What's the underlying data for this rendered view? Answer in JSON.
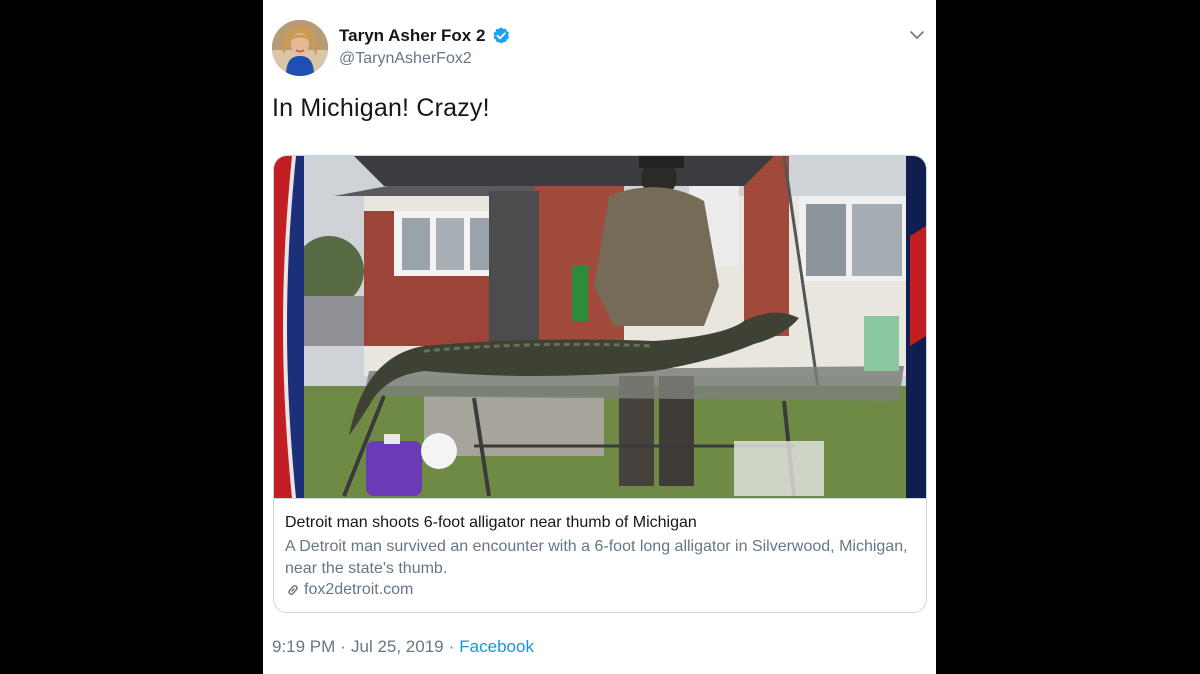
{
  "tweet": {
    "display_name": "Taryn Asher Fox 2",
    "handle": "@TarynAsherFox2",
    "text": "In Michigan! Crazy!",
    "time": "9:19 PM",
    "separator1": "·",
    "date": "Jul 25, 2019",
    "separator2": "·",
    "source": "Facebook"
  },
  "card": {
    "title": "Detroit man shoots 6-foot alligator near thumb of Michigan",
    "description": "A Detroit man survived an encounter with a 6-foot long alligator in Silverwood, Michigan, near the state's thumb.",
    "domain": "fox2detroit.com"
  },
  "icons": {
    "verified": "verified-badge-icon",
    "caret": "chevron-down-icon",
    "link": "link-icon"
  },
  "colors": {
    "verified": "#1da1f2",
    "link": "#1b95e0",
    "secondary_text": "#657786",
    "primary_text": "#14171a"
  }
}
